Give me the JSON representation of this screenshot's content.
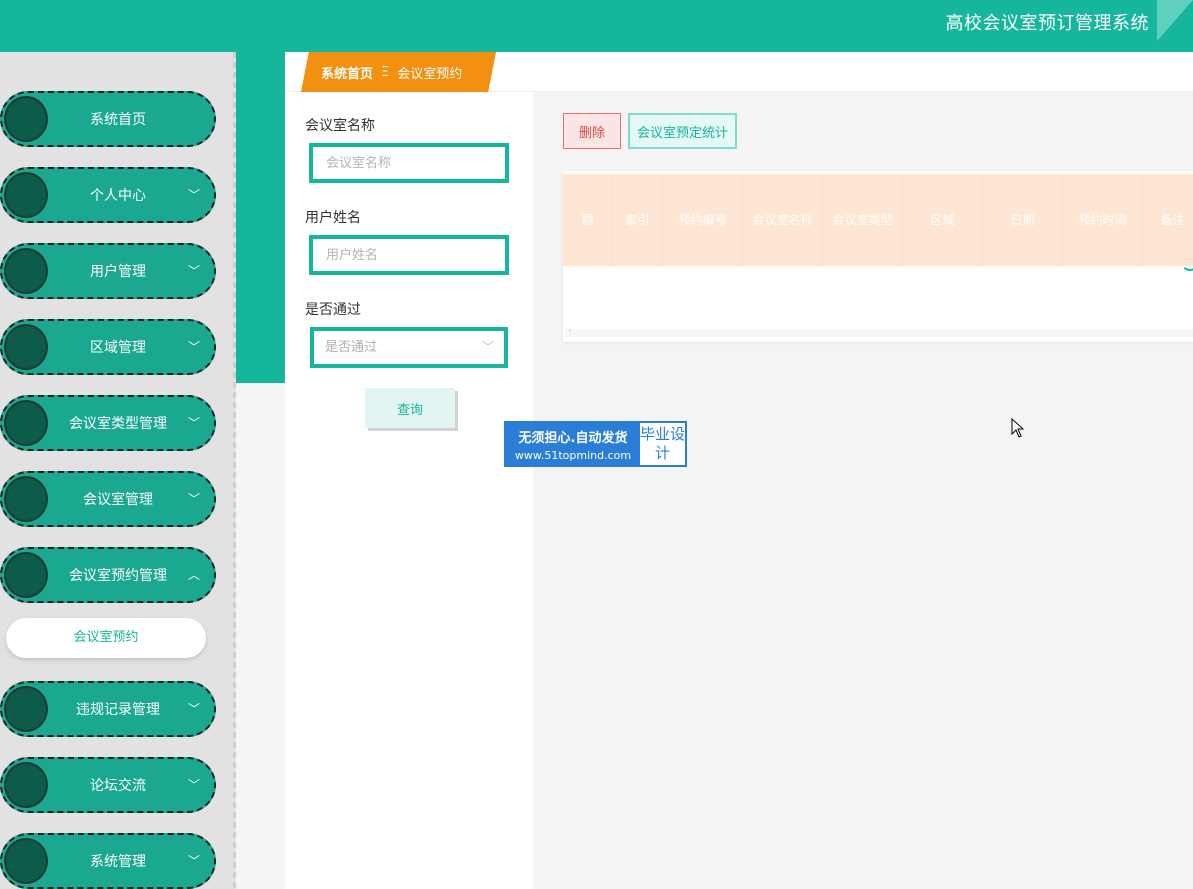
{
  "header": {
    "app_title": "高校会议室预订管理系统"
  },
  "sidebar": {
    "items": [
      {
        "label": "系统首页",
        "chevron": ""
      },
      {
        "label": "个人中心",
        "chevron": "﹀"
      },
      {
        "label": "用户管理",
        "chevron": "﹀"
      },
      {
        "label": "区域管理",
        "chevron": "﹀"
      },
      {
        "label": "会议室类型管理",
        "chevron": "﹀"
      },
      {
        "label": "会议室管理",
        "chevron": "﹀"
      },
      {
        "label": "会议室预约管理",
        "chevron": "︿"
      },
      {
        "label": "违规记录管理",
        "chevron": "﹀"
      },
      {
        "label": "论坛交流",
        "chevron": "﹀"
      },
      {
        "label": "系统管理",
        "chevron": "﹀"
      }
    ],
    "active_sub_item": "会议室预约"
  },
  "breadcrumb": {
    "home": "系统首页",
    "separator": "Ξ",
    "current": "会议室预约"
  },
  "search": {
    "room_name_label": "会议室名称",
    "room_name_placeholder": "会议室名称",
    "user_name_label": "用户姓名",
    "user_name_placeholder": "用户姓名",
    "approved_label": "是否通过",
    "approved_placeholder": "是否通过",
    "query_button": "查询"
  },
  "actions": {
    "delete_button": "删除",
    "stats_button": "会议室预定统计"
  },
  "table": {
    "columns": [
      "题",
      "索引",
      "预约编号",
      "会议室名称",
      "会议室类型",
      "区域",
      "日期",
      "预约时间",
      "备注"
    ]
  },
  "watermark": {
    "line1": "无须担心.自动发货",
    "line2": "www.51topmind.com",
    "badge": "毕业设计"
  },
  "colors": {
    "primary": "#16b69d",
    "accent_orange": "#f39010",
    "danger": "#e04747"
  },
  "icons": {
    "chevron": "chevron-down-icon",
    "cursor": "mouse-pointer-icon"
  }
}
